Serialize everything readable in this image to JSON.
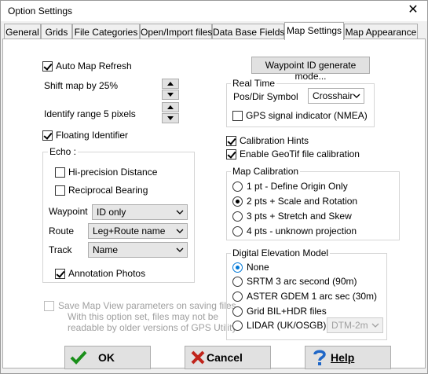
{
  "window": {
    "title": "Option Settings",
    "close_symbol": "✕"
  },
  "tabs": [
    {
      "label": "General"
    },
    {
      "label": "Grids"
    },
    {
      "label": "File Categories"
    },
    {
      "label": "Open/Import files"
    },
    {
      "label": "Data Base Fields"
    },
    {
      "label": "Map Settings",
      "active": true
    },
    {
      "label": "Map Appearance"
    }
  ],
  "left": {
    "auto_map_refresh": {
      "label": "Auto Map Refresh",
      "checked": true
    },
    "shift_map": "Shift map by 25%",
    "identify_range": "Identify range  5 pixels",
    "floating_identifier": {
      "label": "Floating Identifier",
      "checked": true
    },
    "echo": {
      "title": "Echo :",
      "hi_precision": {
        "label": "Hi-precision Distance",
        "checked": false
      },
      "reciprocal": {
        "label": "Reciprocal Bearing",
        "checked": false
      },
      "waypoint": {
        "label": "Waypoint",
        "value": "ID only"
      },
      "route": {
        "label": "Route",
        "value": "Leg+Route name"
      },
      "track": {
        "label": "Track",
        "value": "Name"
      },
      "annotation_photos": {
        "label": "Annotation Photos",
        "checked": true
      }
    },
    "save_map_view": {
      "label": "Save Map View parameters on saving files",
      "note1": "With this option set, files may not be",
      "note2": "readable by older versions of GPS Utility.",
      "checked": false
    }
  },
  "right": {
    "waypoint_id_button": "Waypoint ID generate mode...",
    "real_time": {
      "title": "Real Time",
      "pos_dir_label": "Pos/Dir Symbol",
      "pos_dir_value": "Crosshair",
      "gps_signal": {
        "label": "GPS signal indicator (NMEA)",
        "checked": false
      }
    },
    "calibration_hints": {
      "label": "Calibration Hints",
      "checked": true
    },
    "geotif": {
      "label": "Enable GeoTif file calibration",
      "checked": true
    },
    "map_calibration": {
      "title": "Map Calibration",
      "options": [
        {
          "label": "1 pt - Define Origin Only",
          "checked": false
        },
        {
          "label": "2 pts + Scale and Rotation",
          "checked": true
        },
        {
          "label": "3 pts + Stretch and Skew",
          "checked": false
        },
        {
          "label": "4 pts - unknown projection",
          "checked": false
        }
      ]
    },
    "dem": {
      "title": "Digital Elevation Model",
      "options": [
        {
          "label": "None",
          "checked": true
        },
        {
          "label": "SRTM 3 arc second (90m)",
          "checked": false
        },
        {
          "label": "ASTER GDEM 1 arc sec (30m)",
          "checked": false
        },
        {
          "label": "Grid BIL+HDR files",
          "checked": false
        },
        {
          "label": "LIDAR (UK/OSGB)",
          "checked": false
        }
      ],
      "lidar_select": "DTM-2m"
    }
  },
  "buttons": {
    "ok": "OK",
    "cancel": "Cancel",
    "help": "Help"
  },
  "colors": {
    "ok_check": "#1a8f1a",
    "cancel_x": "#c0241b",
    "help_q": "#1e66c7",
    "accent": "#0078d7"
  }
}
